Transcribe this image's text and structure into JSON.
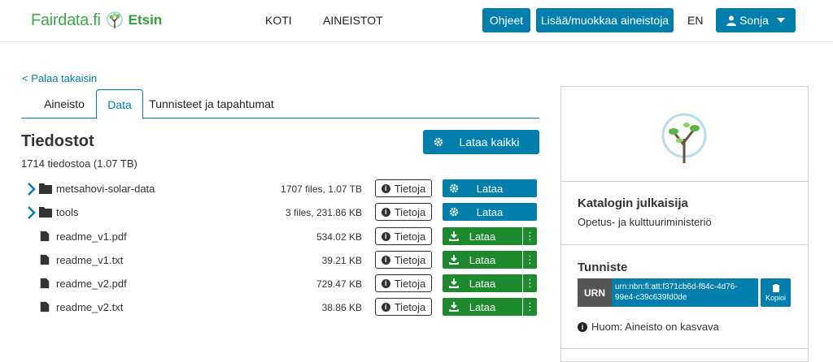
{
  "header": {
    "logo_text": "Fairdata.fi",
    "logo_sub": "Etsin",
    "nav": [
      "KOTI",
      "AINEISTOT"
    ],
    "help_label": "Ohjeet",
    "add_label": "Lisää/muokkaa aineistoja",
    "lang": "EN",
    "user_label": "Sonja"
  },
  "back_label": "< Palaa takaisin",
  "tabs": [
    {
      "label": "Aineisto",
      "active": false
    },
    {
      "label": "Data",
      "active": true
    },
    {
      "label": "Tunnisteet ja tapahtumat",
      "active": false
    }
  ],
  "files": {
    "title": "Tiedostot",
    "summary": "1714 tiedostoa (1.07 TB)",
    "download_all_label": "Lataa kaikki",
    "info_label": "Tietoja",
    "download_label": "Lataa",
    "rows": [
      {
        "type": "folder",
        "name": "metsahovi-solar-data",
        "size": "1707 files, 1.07 TB"
      },
      {
        "type": "folder",
        "name": "tools",
        "size": "3 files, 231.86 KB"
      },
      {
        "type": "file",
        "name": "readme_v1.pdf",
        "size": "534.02 KB"
      },
      {
        "type": "file",
        "name": "readme_v1.txt",
        "size": "39.21 KB"
      },
      {
        "type": "file",
        "name": "readme_v2.pdf",
        "size": "729.47 KB"
      },
      {
        "type": "file",
        "name": "readme_v2.txt",
        "size": "38.86 KB"
      }
    ]
  },
  "sidebar": {
    "publisher_label": "Katalogin julkaisija",
    "publisher_value": "Opetus- ja kulttuuriministeriö",
    "identifier_label": "Tunniste",
    "urn_tag": "URN",
    "urn_value": "urn:nbn:fi:att:f371cb6d-f84c-4d76-99e4-c39c639fd0de",
    "copy_label": "Kopioi",
    "note": "Huom: Aineisto on kasvava"
  },
  "colors": {
    "primary": "#007fad",
    "green": "#1d8a2e",
    "logo_green": "#3fa84b"
  }
}
